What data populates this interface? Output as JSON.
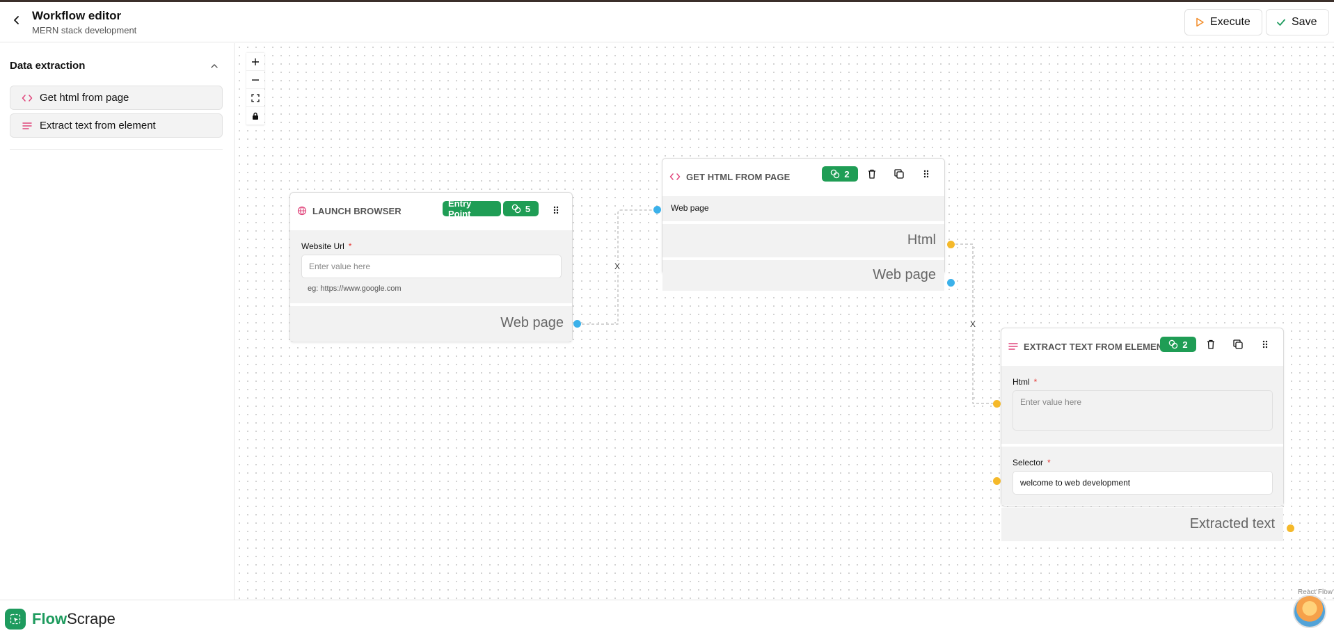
{
  "header": {
    "title": "Workflow editor",
    "subtitle": "MERN stack development",
    "execute_label": "Execute",
    "save_label": "Save"
  },
  "sidebar": {
    "section_title": "Data extraction",
    "items": [
      {
        "label": "Get html from page",
        "icon": "code-icon"
      },
      {
        "label": "Extract text from element",
        "icon": "text-lines-icon"
      }
    ]
  },
  "canvas": {
    "controls": [
      "zoom-in",
      "zoom-out",
      "fit-view",
      "lock"
    ],
    "attribution": "React Flow",
    "nodes": {
      "launch": {
        "title": "LAUNCH BROWSER",
        "entry_badge": "Entry Point",
        "credits": "5",
        "field_label": "Website Url",
        "field_placeholder": "Enter value here",
        "field_hint": "eg: https://www.google.com",
        "output": "Web page"
      },
      "gethtml": {
        "title": "GET HTML FROM PAGE",
        "credits": "2",
        "input": "Web page",
        "outputs": [
          "Html",
          "Web page"
        ]
      },
      "extract": {
        "title": "EXTRACT TEXT FROM ELEMENT",
        "credits": "2",
        "html_label": "Html",
        "html_placeholder": "Enter value here",
        "selector_label": "Selector",
        "selector_value": "welcome to web development",
        "output": "Extracted text"
      }
    },
    "edge_delete_label": "X"
  },
  "brand": {
    "flow": "Flow",
    "scrape": "Scrape",
    "accent": "#1e9b5e"
  },
  "colors": {
    "badge": "#1f9d55",
    "handle_browser": "#3bb1ea",
    "handle_string": "#f5b92a",
    "icon_accent": "#e0457b"
  }
}
